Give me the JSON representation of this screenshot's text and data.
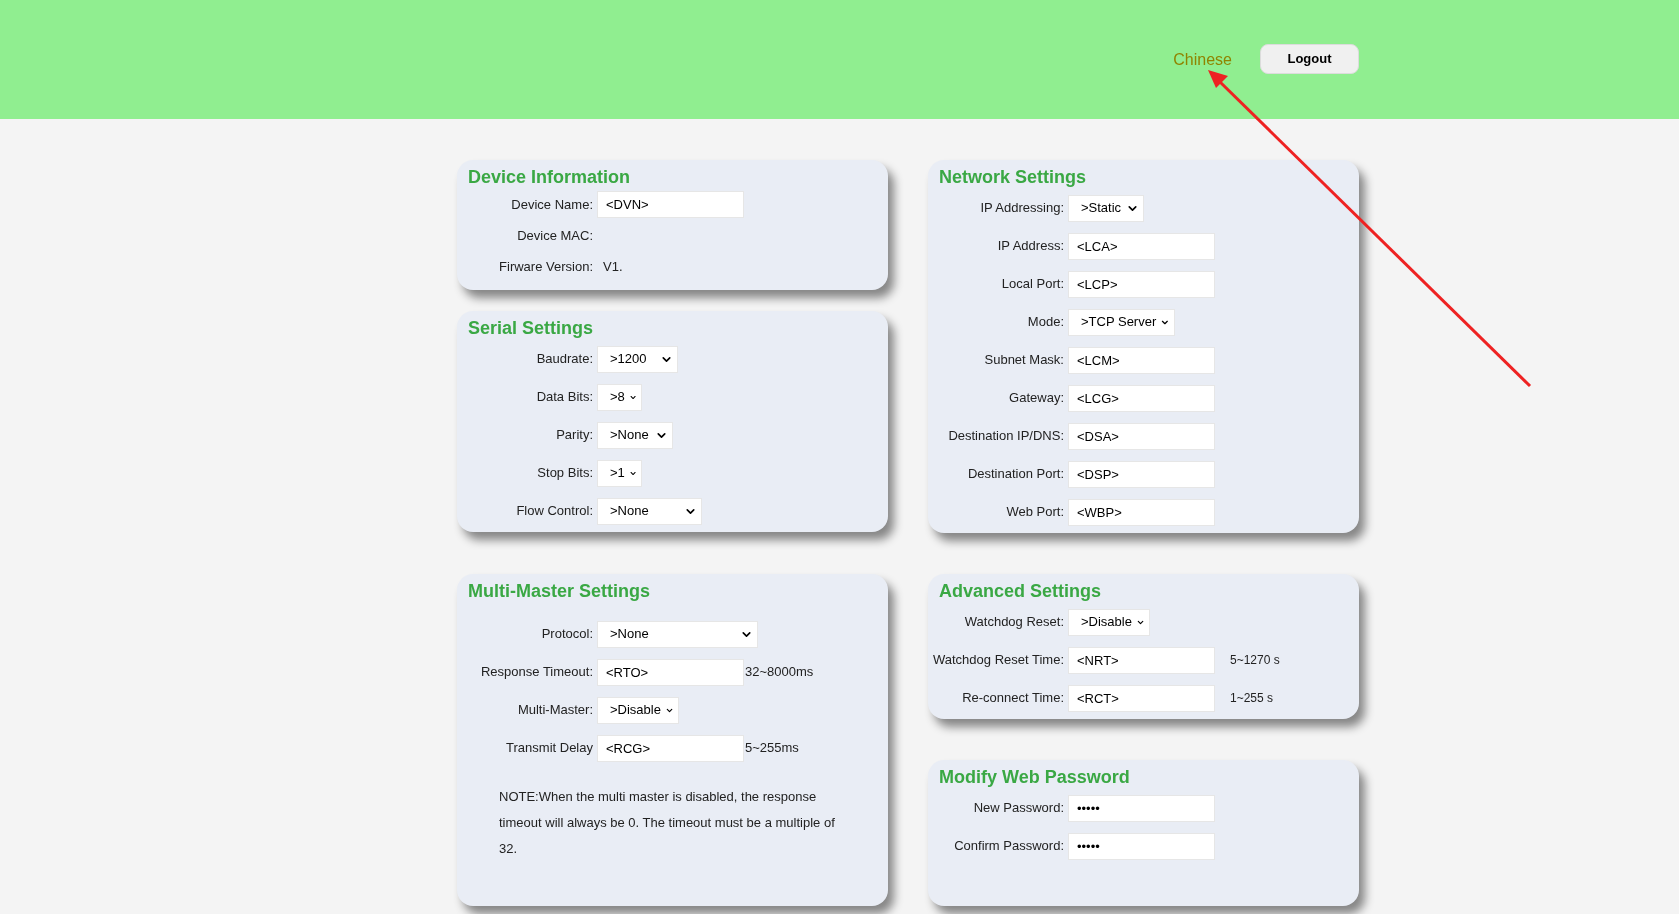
{
  "header": {
    "language_link": "Chinese",
    "logout_button": "Logout"
  },
  "left_column": [
    {
      "title": "Device Information",
      "rows": [
        {
          "kind": "input",
          "label": "Device Name:",
          "value": "<DVN>"
        },
        {
          "kind": "static",
          "label": "Device MAC:"
        },
        {
          "kind": "static",
          "label": "Firware Version:",
          "value": "V1."
        }
      ]
    },
    {
      "title": "Serial Settings",
      "rows": [
        {
          "kind": "select",
          "label": "Baudrate:",
          "value": ">1200"
        },
        {
          "kind": "select",
          "label": "Data Bits:",
          "value": ">8"
        },
        {
          "kind": "select",
          "label": "Parity:",
          "value": ">None"
        },
        {
          "kind": "select",
          "label": "Stop Bits:",
          "value": ">1"
        },
        {
          "kind": "select",
          "label": "Flow Control:",
          "value": ">None"
        }
      ]
    },
    {
      "title": "Multi-Master Settings",
      "rows": [
        {
          "kind": "select",
          "label": "Protocol:",
          "value": ">None"
        },
        {
          "kind": "input",
          "label": "Response Timeout:",
          "value": "<RTO>",
          "unit": "32~8000ms"
        },
        {
          "kind": "select",
          "label": "Multi-Master:",
          "value": ">Disable"
        },
        {
          "kind": "input",
          "label": "Transmit Delay",
          "value": "<RCG>",
          "unit": "5~255ms"
        }
      ],
      "note": "NOTE:When the multi master is disabled, the response timeout will always be 0. The timeout must be a multiple of 32."
    }
  ],
  "right_column": [
    {
      "title": "Network Settings",
      "rows": [
        {
          "kind": "select",
          "label": "IP Addressing:",
          "value": ">Static"
        },
        {
          "kind": "input",
          "label": "IP Address:",
          "value": "<LCA>"
        },
        {
          "kind": "input",
          "label": "Local Port:",
          "value": "<LCP>"
        },
        {
          "kind": "select",
          "label": "Mode:",
          "value": ">TCP Server"
        },
        {
          "kind": "input",
          "label": "Subnet Mask:",
          "value": "<LCM>"
        },
        {
          "kind": "input",
          "label": "Gateway:",
          "value": "<LCG>"
        },
        {
          "kind": "input",
          "label": "Destination IP/DNS:",
          "value": "<DSA>"
        },
        {
          "kind": "input",
          "label": "Destination Port:",
          "value": "<DSP>"
        },
        {
          "kind": "input",
          "label": "Web Port:",
          "value": "<WBP>"
        }
      ]
    },
    {
      "title": "Advanced Settings",
      "rows": [
        {
          "kind": "select",
          "label": "Watchdog Reset:",
          "value": ">Disable"
        },
        {
          "kind": "input",
          "label": "Watchdog Reset Time:",
          "value": "<NRT>",
          "unit": "5~1270 s"
        },
        {
          "kind": "input",
          "label": "Re-connect Time:",
          "value": "<RCT>",
          "unit": "1~255 s"
        }
      ]
    },
    {
      "title": "Modify Web Password",
      "rows": [
        {
          "kind": "input",
          "label": "New Password:",
          "value": "•••••"
        },
        {
          "kind": "input",
          "label": "Confirm Password:",
          "value": "•••••"
        }
      ]
    }
  ]
}
